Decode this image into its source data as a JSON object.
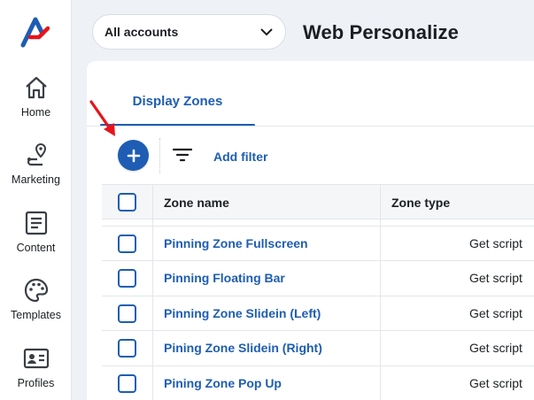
{
  "sidebar": {
    "logo": "brand-logo",
    "items": [
      {
        "label": "Home",
        "icon": "home-icon"
      },
      {
        "label": "Marketing",
        "icon": "route-pin-icon"
      },
      {
        "label": "Content",
        "icon": "document-icon"
      },
      {
        "label": "Templates",
        "icon": "palette-icon"
      },
      {
        "label": "Profiles",
        "icon": "id-card-icon"
      }
    ]
  },
  "header": {
    "account_select": "All accounts",
    "title": "Web Personalize"
  },
  "tabs": [
    {
      "label": "Display Zones",
      "active": true
    }
  ],
  "toolbar": {
    "add_icon": "plus-icon",
    "filter_icon": "filter-lines-icon",
    "add_filter_label": "Add filter"
  },
  "table": {
    "columns": [
      "Zone name",
      "Zone type"
    ],
    "rows": [
      {
        "name": "Pinning Zone Fullscreen",
        "type": "Get script"
      },
      {
        "name": "Pinning Floating Bar",
        "type": "Get script"
      },
      {
        "name": "Pinning Zone Slidein (Left)",
        "type": "Get script"
      },
      {
        "name": "Pining Zone Slidein (Right)",
        "type": "Get script"
      },
      {
        "name": "Pining Zone Pop Up",
        "type": "Get script"
      }
    ]
  },
  "colors": {
    "accent": "#1e5db3",
    "annotation": "#e8131b"
  }
}
